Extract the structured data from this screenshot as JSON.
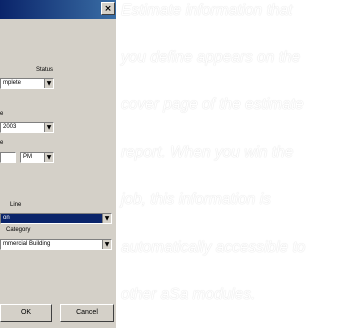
{
  "dialog": {
    "title_close_glyph": "×",
    "estimate_status_label": "Status",
    "estimate_status_value": "mplete",
    "date_label": "e",
    "date_value": "2003",
    "time_label": "e",
    "time_ampm_value": "PM",
    "business_line_label": "Line",
    "business_line_value": "on",
    "job_category_label": "Category",
    "job_category_value": "mmercial Building",
    "ok_label": "OK",
    "cancel_label": "Cancel",
    "dropdown_glyph": "▼"
  },
  "info": {
    "lines": [
      "Estimate information that",
      "you define appears on the",
      "cover page of the estimate",
      "report. When you win the",
      "job, this information is",
      "automatically accessible to",
      "other aSa modules."
    ]
  }
}
